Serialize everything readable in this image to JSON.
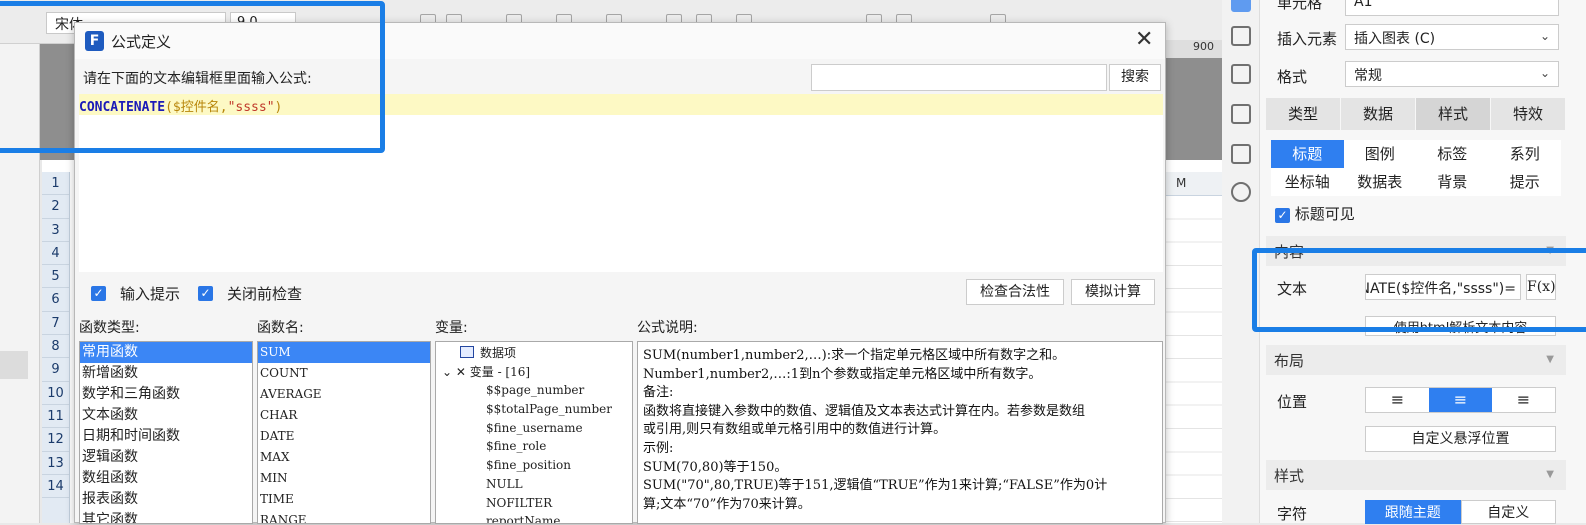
{
  "toolbar": {
    "font_name": "宋体",
    "font_size": "9.0"
  },
  "row_headers": [
    "1",
    "2",
    "3",
    "4",
    "5",
    "6",
    "7",
    "8",
    "9",
    "10",
    "11",
    "12",
    "13",
    "14"
  ],
  "sheet": {
    "ruler_value": "900",
    "col_header": "M"
  },
  "panel": {
    "cell_label": "单元格",
    "cell_value": "A1",
    "insert_label": "插入元素",
    "insert_value": "插入图表 (C)",
    "format_label": "格式",
    "format_value": "常规",
    "tabs": [
      "类型",
      "数据",
      "样式",
      "特效"
    ],
    "subtabs": [
      "标题",
      "图例",
      "标签",
      "系列",
      "坐标轴",
      "数据表",
      "背景",
      "提示"
    ],
    "title_visible": "标题可见",
    "content_section": "内容",
    "text_label": "文本",
    "text_value": "=CONCATENATE($控件名,\"ssss\")",
    "fx_label": "F(x)",
    "html_button": "使用html解析文本内容",
    "layout_section": "布局",
    "position_label": "位置",
    "align_icons": [
      "≡",
      "≡",
      "≡"
    ],
    "float_button": "自定义悬浮位置",
    "style_section": "样式",
    "font_label": "字符",
    "font_options": [
      "跟随主题",
      "自定义"
    ]
  },
  "dialog": {
    "title": "公式定义",
    "prompt": "请在下面的文本编辑框里面输入公式:",
    "search_button": "搜索",
    "formula_fn": "CONCATENATE",
    "formula_args": "($控件名,",
    "formula_str": "\"ssss\"",
    "formula_close": ")",
    "check_input_hint": "输入提示",
    "check_close_verify": "关闭前检查",
    "check_validity_button": "检查合法性",
    "simulate_button": "模拟计算",
    "func_type_label": "函数类型:",
    "func_name_label": "函数名:",
    "variable_label": "变量:",
    "desc_label": "公式说明:",
    "func_types": [
      "常用函数",
      "新增函数",
      "数学和三角函数",
      "文本函数",
      "日期和时间函数",
      "逻辑函数",
      "数组函数",
      "报表函数",
      "其它函数"
    ],
    "func_names": [
      "SUM",
      "COUNT",
      "AVERAGE",
      "CHAR",
      "DATE",
      "MAX",
      "MIN",
      "TIME",
      "RANGE"
    ],
    "tree_items": [
      "数据项",
      "变量 - [16]",
      "$$page_number",
      "$$totalPage_number",
      "$fine_username",
      "$fine_role",
      "$fine_position",
      "NULL",
      "NOFILTER",
      "reportName"
    ],
    "desc_lines": [
      "SUM(number1,number2,…):求一个指定单元格区域中所有数字之和。",
      "Number1,number2,…:1到n个参数或指定单元格区域中所有数字。",
      "备注:",
      "函数将直接键入参数中的数值、逻辑值及文本表达式计算在内。若参数是数组",
      "或引用,则只有数组或单元格引用中的数值进行计算。",
      "示例:",
      "SUM(70,80)等于150。",
      "SUM(\"70\",80,TRUE)等于151,逻辑值“TRUE”作为1来计算;“FALSE”作为0计",
      "算;文本“70”作为70来计算。"
    ]
  }
}
